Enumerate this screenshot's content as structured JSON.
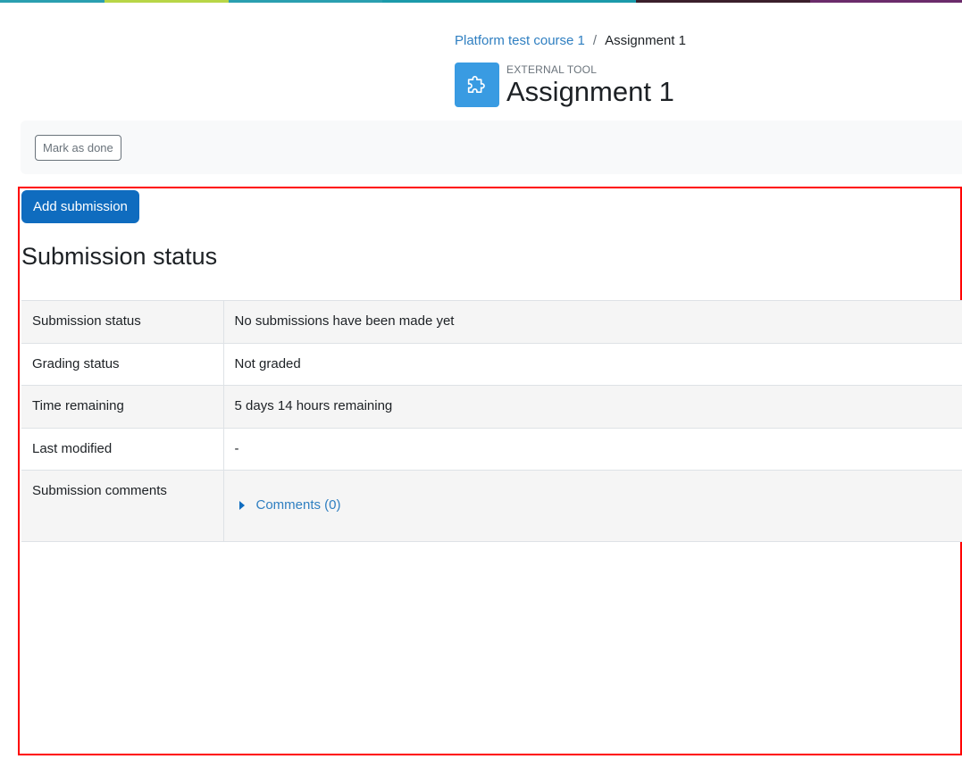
{
  "colors": {
    "topbar": [
      "#2a9fb0",
      "#b8d647",
      "#2a9fb0",
      "#1b9aaa",
      "#3b1f2b",
      "#6b2b6b"
    ],
    "primary": "#0f6cbf",
    "link": "#2f7fc1",
    "activity_icon_bg": "#399be2",
    "region_highlight": "#ff0000"
  },
  "breadcrumb": {
    "course": "Platform test course 1",
    "separator": "/",
    "current": "Assignment 1"
  },
  "header": {
    "icon": "puzzle-icon",
    "activity_type": "External tool",
    "title": "Assignment 1"
  },
  "completion": {
    "mark_done_label": "Mark as done"
  },
  "actions": {
    "add_submission_label": "Add submission"
  },
  "submission": {
    "heading": "Submission status",
    "rows": [
      {
        "label": "Submission status",
        "value": "No submissions have been made yet"
      },
      {
        "label": "Grading status",
        "value": "Not graded"
      },
      {
        "label": "Time remaining",
        "value": "5 days 14 hours remaining"
      },
      {
        "label": "Last modified",
        "value": "-"
      },
      {
        "label": "Submission comments",
        "value": "Comments (0)"
      }
    ]
  }
}
